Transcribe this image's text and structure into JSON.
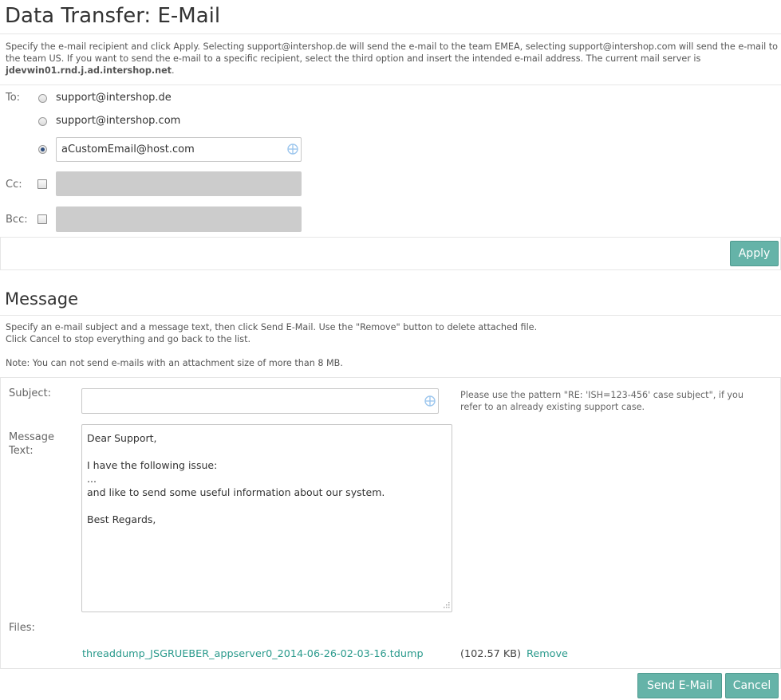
{
  "page": {
    "title": "Data Transfer: E-Mail",
    "description_prefix": "Specify the e-mail recipient and click Apply. Selecting support@intershop.de will send the e-mail to the team EMEA, selecting support@intershop.com will send the e-mail to the team US. If you want to send the e-mail to a specific recipient, select the third option and insert the intended e-mail address. The current mail server is",
    "mail_server": "jdevwin01.rnd.j.ad.intershop.net",
    "description_suffix": "."
  },
  "recipients": {
    "to_label": "To:",
    "options": [
      {
        "label": "support@intershop.de",
        "checked": false
      },
      {
        "label": "support@intershop.com",
        "checked": false
      },
      {
        "value": "aCustomEmail@host.com",
        "checked": true
      }
    ],
    "cc_label": "Cc:",
    "bcc_label": "Bcc:",
    "cc_checked": false,
    "bcc_checked": false,
    "apply_label": "Apply"
  },
  "message": {
    "title": "Message",
    "description_line1": "Specify an e-mail subject and a message text, then click Send E-Mail. Use the \"Remove\" button to delete attached file.",
    "description_line2": "Click Cancel to stop everything and go back to the list.",
    "note": "Note: You can not send e-mails with an attachment size of more than 8 MB.",
    "subject_label": "Subject:",
    "subject_value": "",
    "subject_hint": "Please use the pattern \"RE: 'ISH=123-456' case subject\", if you refer to an already existing support case.",
    "text_label_line1": "Message",
    "text_label_line2": "Text:",
    "text_value": "Dear Support,\n\nI have the following issue:\n...\nand like to send some useful information about our system.\n\nBest Regards,",
    "files_label": "Files:",
    "file_name": "threaddump_JSGRUEBER_appserver0_2014-06-26-02-03-16.tdump",
    "file_size": "(102.57 KB)",
    "remove_label": "Remove",
    "send_label": "Send E-Mail",
    "cancel_label": "Cancel"
  },
  "colors": {
    "accent": "#65b3a8",
    "link": "#2a9a8c",
    "disabled_field": "#cccccc"
  }
}
